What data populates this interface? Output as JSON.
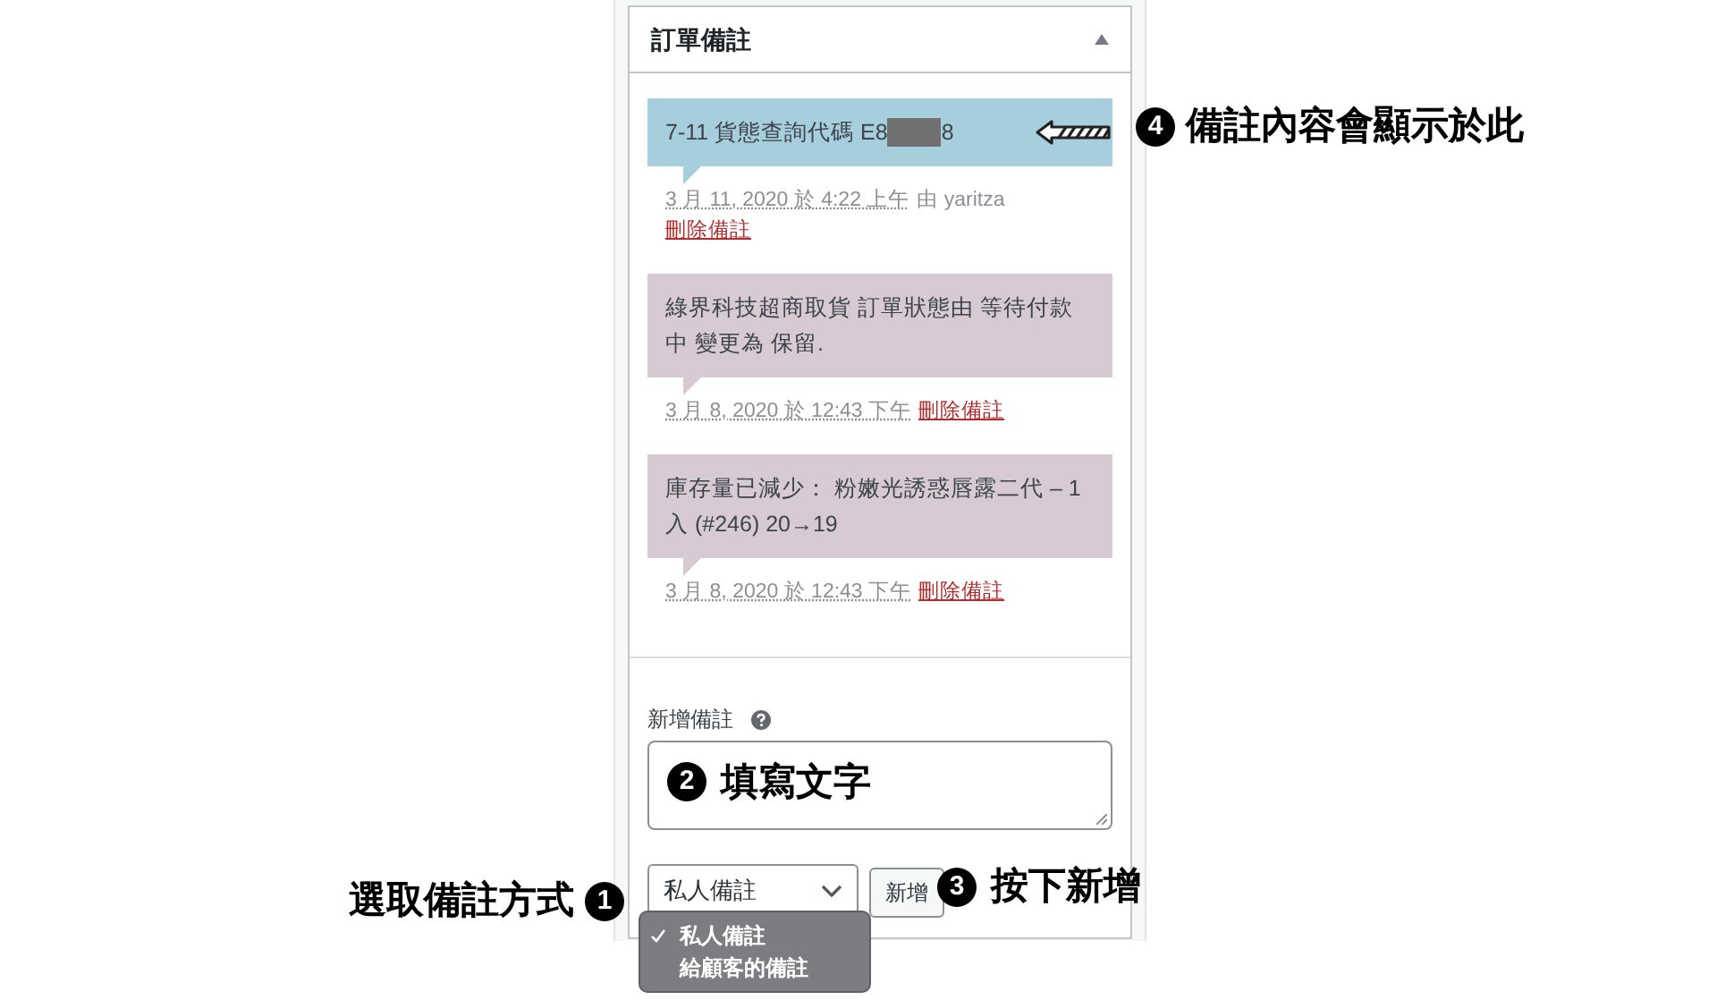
{
  "panel": {
    "title": "訂單備註",
    "expanded": true
  },
  "notes": [
    {
      "kind": "customer",
      "content": "7-11 貨態查詢代碼 E8",
      "redacted": true,
      "content_after": "8",
      "date": "3 月 11, 2020 於 4:22 上午",
      "author": "由 yaritza",
      "delete_link": "刪除備註"
    },
    {
      "kind": "private",
      "content": "綠界科技超商取貨 訂單狀態由 等待付款中 變更為 保留.",
      "date": "3 月 8, 2020 於 12:43 下午",
      "delete_link": "刪除備註"
    },
    {
      "kind": "private",
      "content": "庫存量已減少： 粉嫩光誘惑唇露二代 – 1 入 (#246) 20→19",
      "date": "3 月 8, 2020 於 12:43 下午",
      "delete_link": "刪除備註"
    }
  ],
  "add_note": {
    "label": "新增備註",
    "value_badge": "2",
    "value": "填寫文字",
    "note_type": "私人備註",
    "button": "新增",
    "options": [
      {
        "label": "私人備註",
        "selected": true
      },
      {
        "label": "給顧客的備註",
        "selected": false
      }
    ]
  },
  "annotations": [
    {
      "number": "4",
      "text": "備註內容會顯示於此"
    },
    {
      "number": "3",
      "text": "按下新增"
    },
    {
      "number": "1",
      "text": "選取備註方式"
    }
  ]
}
